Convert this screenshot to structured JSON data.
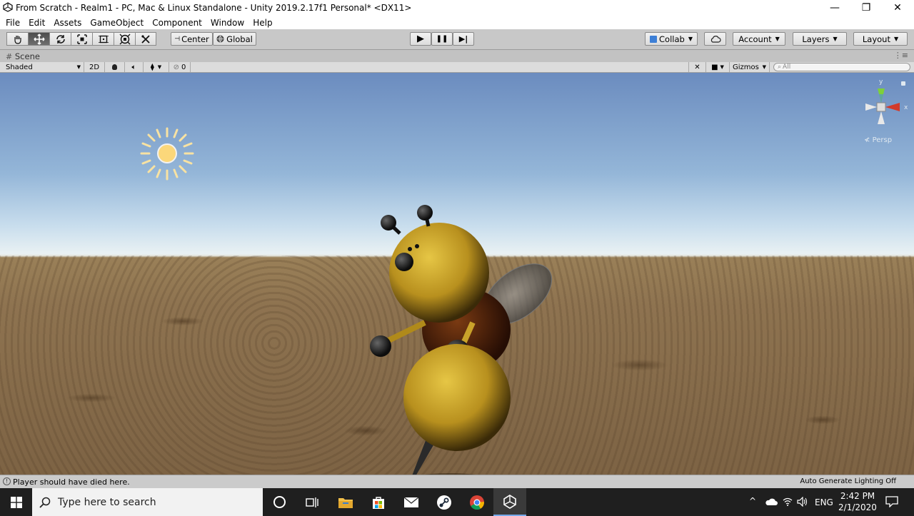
{
  "window": {
    "title": "From Scratch - Realm1 - PC, Mac & Linux Standalone - Unity 2019.2.17f1 Personal* <DX11>",
    "minimize_glyph": "—",
    "restore_glyph": "❐",
    "close_glyph": "✕"
  },
  "menu": [
    "File",
    "Edit",
    "Assets",
    "GameObject",
    "Component",
    "Window",
    "Help"
  ],
  "toolbar": {
    "tools": [
      "hand-tool",
      "move-tool",
      "rotate-tool",
      "scale-tool",
      "rect-tool",
      "transform-tool",
      "custom-tool"
    ],
    "active_tool": "move-tool",
    "pivot_label": "Center",
    "space_label": "Global",
    "play_glyph": "▶",
    "pause_glyph": "❚❚",
    "step_glyph": "▶|",
    "collab_label": "Collab",
    "account_label": "Account",
    "layers_label": "Layers",
    "layout_label": "Layout"
  },
  "scene": {
    "tab_label": "Scene",
    "shading_mode": "Shaded",
    "mode_2d": "2D",
    "hidden_count": "0",
    "gizmos_label": "Gizmos",
    "search_placeholder": "All",
    "persp_label": "Persp",
    "axis_y": "y",
    "axis_x": "x"
  },
  "status": {
    "message": "Player should have died here.",
    "lighting": "Auto Generate Lighting Off"
  },
  "taskbar": {
    "search_placeholder": "Type here to search",
    "language": "ENG",
    "time": "2:42 PM",
    "date": "2/1/2020"
  },
  "colors": {
    "toolbar_bg": "#c8c8c8",
    "sky_top": "#6b8cbf",
    "ground": "#8e7350",
    "bee_yellow": "#c9a22a",
    "taskbar": "#1f1f1f"
  }
}
